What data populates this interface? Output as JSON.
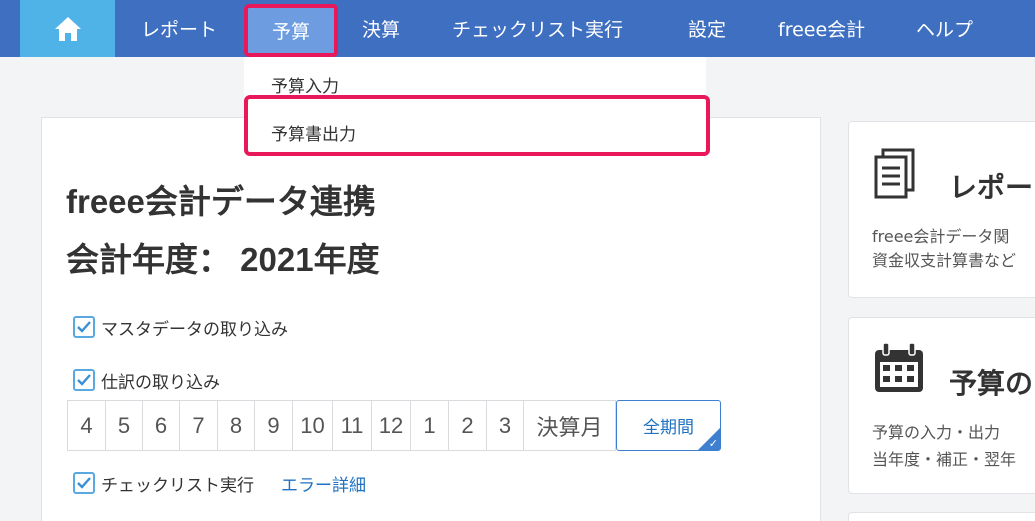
{
  "nav": {
    "items": [
      "レポート",
      "予算",
      "決算",
      "チェックリスト実行",
      "設定",
      "freee会計",
      "ヘルプ"
    ],
    "active": "予算"
  },
  "dropdown": {
    "items": [
      "予算入力",
      "予算書出力"
    ],
    "highlighted": "予算書出力"
  },
  "main": {
    "title_line1": "freee会計データ連携",
    "title_line2": "会計年度： 2021年度",
    "checkboxes": {
      "master": "マスタデータの取り込み",
      "journal": "仕訳の取り込み",
      "checklist": "チェックリスト実行"
    },
    "error_link": "エラー詳細",
    "months": [
      "4",
      "5",
      "6",
      "7",
      "8",
      "9",
      "10",
      "11",
      "12",
      "1",
      "2",
      "3",
      "決算月"
    ],
    "all_period": "全期間"
  },
  "right_cards": {
    "report": {
      "title": "レポー",
      "line1": "freee会計データ関",
      "line2": "資金収支計算書など"
    },
    "budget": {
      "title": "予算の",
      "line1": "予算の入力・出力",
      "line2": "当年度・補正・翌年"
    }
  },
  "colors": {
    "nav": "#3f6fc1",
    "home": "#4fb3e8",
    "active": "#6d9de0",
    "highlight": "#e8185b",
    "link": "#1f72c2"
  }
}
